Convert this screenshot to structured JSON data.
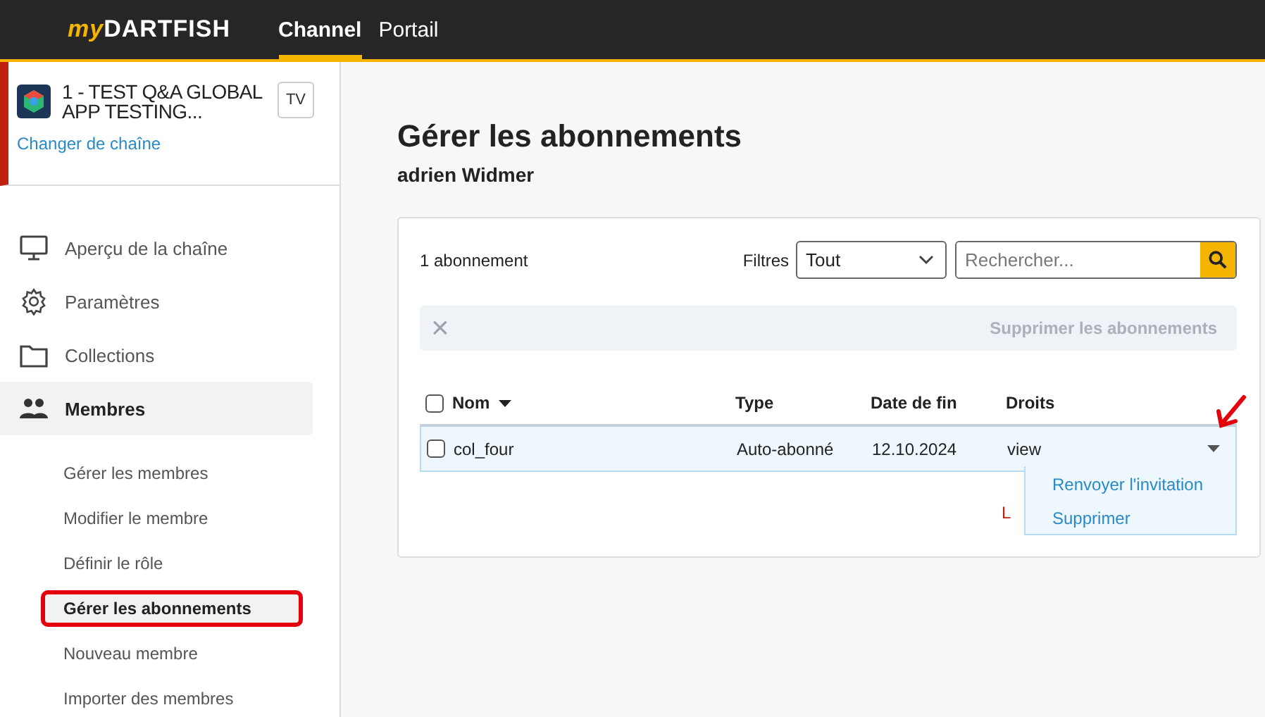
{
  "topbar": {
    "logo_prefix": "my",
    "logo_main": "DARTFISH",
    "tabs": [
      {
        "label": "Channel",
        "selected": true
      },
      {
        "label": "Portail",
        "selected": false
      }
    ]
  },
  "channel": {
    "name": "1 - TEST Q&A GLOBAL APP TESTING...",
    "badge": "TV",
    "change_link": "Changer de chaîne"
  },
  "sidebar": {
    "items": [
      {
        "label": "Aperçu de la chaîne",
        "selected": false
      },
      {
        "label": "Paramètres",
        "selected": false
      },
      {
        "label": "Collections",
        "selected": false
      },
      {
        "label": "Membres",
        "selected": true,
        "children": [
          {
            "label": "Gérer les membres",
            "selected": false,
            "annotated": false
          },
          {
            "label": "Modifier le membre",
            "selected": false,
            "annotated": false
          },
          {
            "label": "Définir le rôle",
            "selected": false,
            "annotated": false
          },
          {
            "label": "Gérer les abonnements",
            "selected": true,
            "annotated": true
          },
          {
            "label": "Nouveau membre",
            "selected": false,
            "annotated": false
          },
          {
            "label": "Importer des membres",
            "selected": false,
            "annotated": false
          }
        ]
      }
    ]
  },
  "page": {
    "title": "Gérer les abonnements",
    "subtitle": "adrien Widmer"
  },
  "panel": {
    "count": "1 abonnement",
    "filter_label": "Filtres",
    "filter_value": "Tout",
    "search_placeholder": "Rechercher...",
    "bulk_bar": {
      "close": "×",
      "action": "Supprimer les abonnements",
      "disabled": true
    },
    "table": {
      "all_checked": false,
      "columns": [
        {
          "label": "Nom",
          "sorted": true
        },
        {
          "label": "Type",
          "sorted": false
        },
        {
          "label": "Date de fin",
          "sorted": false
        },
        {
          "label": "Droits",
          "sorted": false
        }
      ],
      "rows": [
        {
          "checked": false,
          "highlighted": true,
          "cells": [
            "col_four",
            "Auto-abonné",
            "12.10.2024",
            "view"
          ]
        }
      ]
    },
    "footer_text": "L",
    "row_menu": {
      "items": [
        "Renvoyer l'invitation",
        "Supprimer"
      ]
    }
  }
}
